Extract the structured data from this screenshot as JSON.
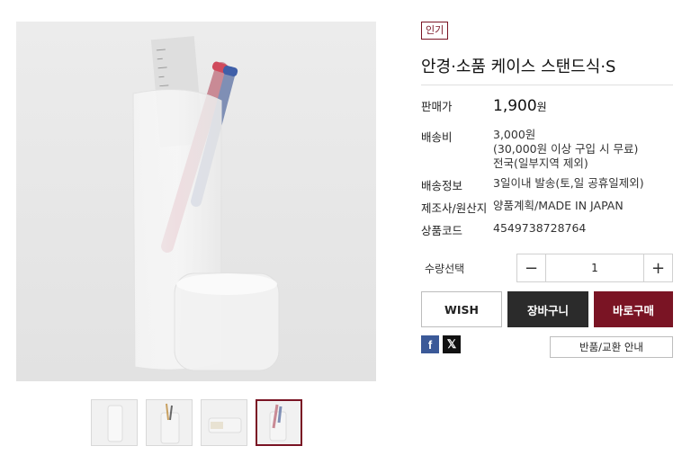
{
  "product": {
    "badge": "인기",
    "title": "안경·소품 케이스 스탠드식·S"
  },
  "details": {
    "price_label": "판매가",
    "price_value": "1,900",
    "price_unit": "원",
    "shipping_label": "배송비",
    "shipping_line1": "3,000원",
    "shipping_line2": "(30,000원 이상 구입 시 무료)",
    "shipping_line3": "전국(일부지역 제외)",
    "delivery_label": "배송정보",
    "delivery_value": "3일이내 발송(토,일 공휴일제외)",
    "maker_label": "제조사/원산지",
    "maker_value": "양품계획/MADE IN JAPAN",
    "code_label": "상품코드",
    "code_value": "4549738728764"
  },
  "quantity": {
    "label": "수량선택",
    "minus": "−",
    "value": "1",
    "plus": "+"
  },
  "actions": {
    "wish": "WISH",
    "cart": "장바구니",
    "buy": "바로구매",
    "return_info": "반품/교환 안내"
  },
  "sns": {
    "facebook": "f",
    "x": "𝕏"
  },
  "icons": [
    "facebook-icon",
    "x-icon"
  ],
  "colors": {
    "accent": "#7a1424",
    "dark_button": "#2b2b2b",
    "facebook": "#3b5998"
  },
  "gallery": {
    "thumbnail_count": 4,
    "active_index": 3
  }
}
